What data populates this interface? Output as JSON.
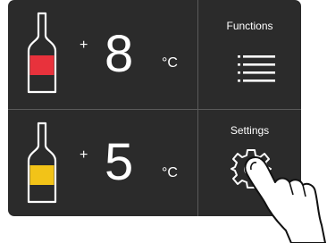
{
  "zones": [
    {
      "sign": "+",
      "temperature": "8",
      "unit": "°C",
      "bottle_label_color": "#e8323c",
      "icon": "wine-bottle-icon"
    },
    {
      "sign": "+",
      "temperature": "5",
      "unit": "°C",
      "bottle_label_color": "#f2c318",
      "icon": "wine-bottle-icon"
    }
  ],
  "buttons": {
    "functions": {
      "label": "Functions",
      "icon": "menu-list-icon"
    },
    "settings": {
      "label": "Settings",
      "icon": "gear-icon"
    }
  },
  "colors": {
    "panel": "#2b2b2b",
    "divider": "#5a5a5a",
    "text": "#ffffff"
  }
}
